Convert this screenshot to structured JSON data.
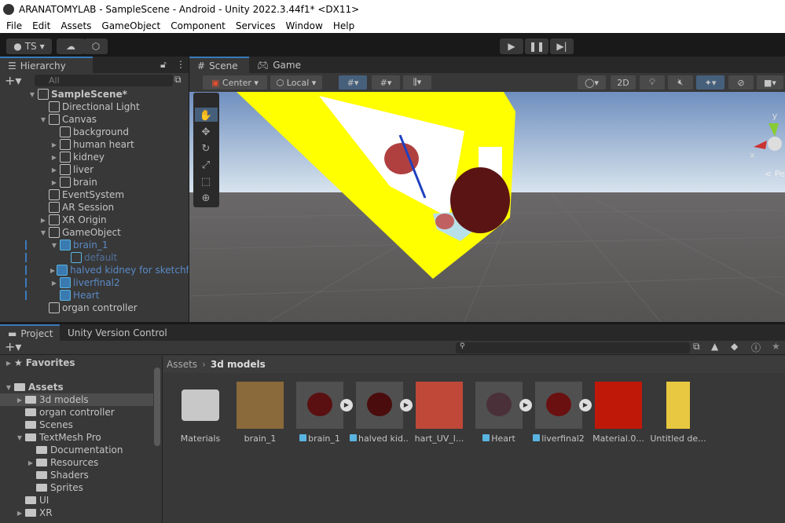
{
  "window": {
    "title": "ARANATOMYLAB - SampleScene - Android - Unity 2022.3.44f1* <DX11>"
  },
  "menu": [
    "File",
    "Edit",
    "Assets",
    "GameObject",
    "Component",
    "Services",
    "Window",
    "Help"
  ],
  "toolbar": {
    "account": "TS"
  },
  "hierarchy": {
    "tab": "Hierarchy",
    "search_placeholder": "All",
    "items": [
      {
        "label": "SampleScene*",
        "depth": 0,
        "arrow": "down",
        "bold": true
      },
      {
        "label": "Directional Light",
        "depth": 1,
        "arrow": ""
      },
      {
        "label": "Canvas",
        "depth": 1,
        "arrow": "down"
      },
      {
        "label": "background",
        "depth": 2,
        "arrow": ""
      },
      {
        "label": "human heart",
        "depth": 2,
        "arrow": "right"
      },
      {
        "label": "kidney",
        "depth": 2,
        "arrow": "right"
      },
      {
        "label": "liver",
        "depth": 2,
        "arrow": "right"
      },
      {
        "label": "brain",
        "depth": 2,
        "arrow": "right"
      },
      {
        "label": "EventSystem",
        "depth": 1,
        "arrow": ""
      },
      {
        "label": "AR Session",
        "depth": 1,
        "arrow": ""
      },
      {
        "label": "XR Origin",
        "depth": 1,
        "arrow": "right"
      },
      {
        "label": "GameObject",
        "depth": 1,
        "arrow": "down"
      },
      {
        "label": "brain_1",
        "depth": 2,
        "arrow": "down",
        "prefab": true
      },
      {
        "label": "default",
        "depth": 3,
        "arrow": "",
        "prefab": true,
        "dim": true
      },
      {
        "label": "halved kidney for sketchfab",
        "depth": 2,
        "arrow": "right",
        "prefab": true
      },
      {
        "label": "liverfinal2",
        "depth": 2,
        "arrow": "right",
        "prefab": true
      },
      {
        "label": "Heart",
        "depth": 2,
        "arrow": "",
        "prefab": true
      },
      {
        "label": "organ controller",
        "depth": 1,
        "arrow": ""
      }
    ]
  },
  "scene": {
    "tabs": [
      "Scene",
      "Game"
    ],
    "pivot": "Center",
    "space": "Local",
    "mode_2d": "2D",
    "persp": "< Persp",
    "gizmo_y": "y",
    "gizmo_x": "x"
  },
  "project": {
    "tabs": [
      "Project",
      "Unity Version Control"
    ],
    "tree": [
      {
        "label": "Favorites",
        "depth": 0,
        "arrow": "right",
        "bold": true,
        "icon": "star"
      },
      {
        "label": "Assets",
        "depth": 0,
        "arrow": "down",
        "bold": true,
        "icon": "folder-open"
      },
      {
        "label": "3d models",
        "depth": 1,
        "arrow": "right",
        "selected": true
      },
      {
        "label": "organ controller",
        "depth": 1,
        "arrow": ""
      },
      {
        "label": "Scenes",
        "depth": 1,
        "arrow": ""
      },
      {
        "label": "TextMesh Pro",
        "depth": 1,
        "arrow": "down"
      },
      {
        "label": "Documentation",
        "depth": 2,
        "arrow": ""
      },
      {
        "label": "Resources",
        "depth": 2,
        "arrow": "right"
      },
      {
        "label": "Shaders",
        "depth": 2,
        "arrow": ""
      },
      {
        "label": "Sprites",
        "depth": 2,
        "arrow": ""
      },
      {
        "label": "UI",
        "depth": 1,
        "arrow": ""
      },
      {
        "label": "XR",
        "depth": 1,
        "arrow": "right"
      }
    ],
    "breadcrumb": [
      "Assets",
      "3d models"
    ],
    "assets": [
      {
        "label": "Materials",
        "kind": "folder"
      },
      {
        "label": "brain_1",
        "kind": "texture",
        "color": "#8a6a3a"
      },
      {
        "label": "brain_1",
        "kind": "model",
        "color": "#5a1010"
      },
      {
        "label": "halved kid...",
        "kind": "model",
        "color": "#4a0c0c"
      },
      {
        "label": "hart_UV_l...",
        "kind": "texture",
        "color": "#c04838"
      },
      {
        "label": "Heart",
        "kind": "model",
        "color": "#4a3038"
      },
      {
        "label": "liverfinal2",
        "kind": "model",
        "color": "#6a1010"
      },
      {
        "label": "Material.0...",
        "kind": "texture",
        "color": "#c01808"
      },
      {
        "label": "Untitled de...",
        "kind": "doc",
        "color": "#e8c840"
      }
    ]
  }
}
